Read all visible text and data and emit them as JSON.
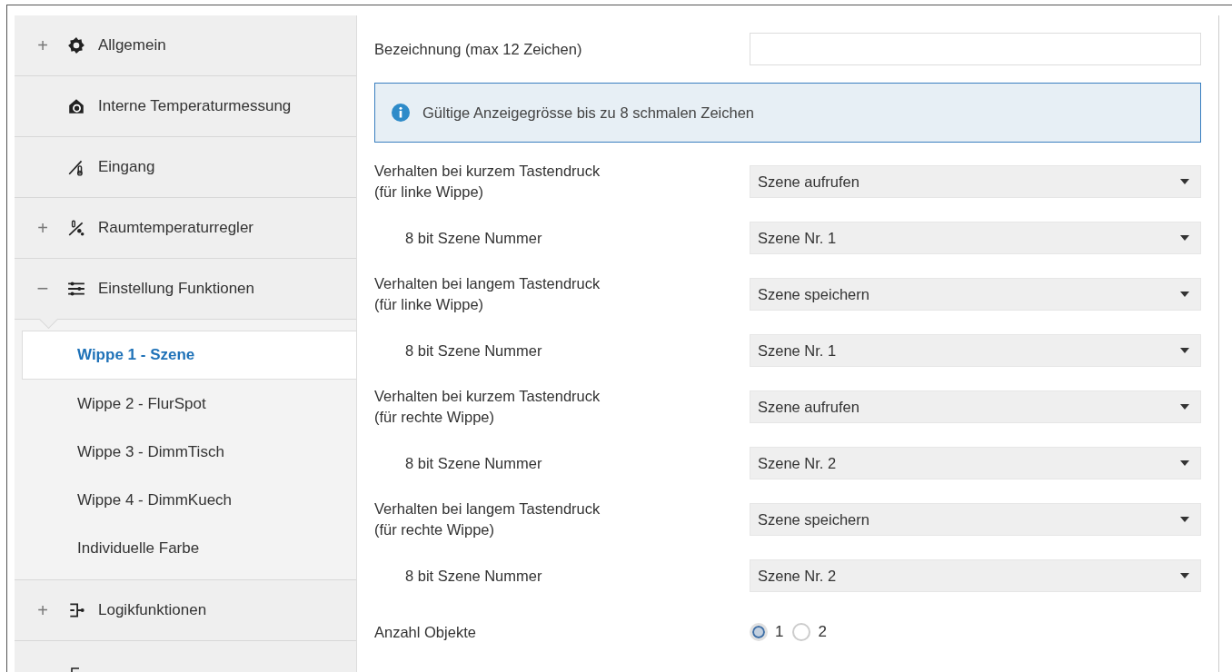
{
  "sidebar": {
    "items": [
      {
        "label": "Allgemein",
        "expander": "+"
      },
      {
        "label": "Interne Temperaturmessung"
      },
      {
        "label": "Eingang"
      },
      {
        "label": "Raumtemperaturregler",
        "expander": "+"
      },
      {
        "label": "Einstellung Funktionen",
        "expander": "−",
        "expanded": true,
        "children": [
          {
            "label": "Wippe 1 - Szene",
            "selected": true
          },
          {
            "label": "Wippe 2 - FlurSpot",
            "selected": false
          },
          {
            "label": "Wippe 3 - DimmTisch",
            "selected": false
          },
          {
            "label": "Wippe 4 - DimmKuech",
            "selected": false
          },
          {
            "label": "Individuelle Farbe",
            "selected": false
          }
        ]
      },
      {
        "label": "Logikfunktionen",
        "expander": "+"
      }
    ]
  },
  "form": {
    "name_field": {
      "label": "Bezeichnung (max 12 Zeichen)"
    },
    "info": "Gültige Anzeigegrösse bis zu 8 schmalen Zeichen",
    "params": [
      {
        "kind": "dropdown",
        "label": "Verhalten bei kurzem Tastendruck\n(für linke Wippe)",
        "indent": false,
        "value": "Szene aufrufen"
      },
      {
        "kind": "dropdown",
        "label": "8 bit Szene Nummer",
        "indent": true,
        "value": "Szene Nr. 1"
      },
      {
        "kind": "dropdown",
        "label": "Verhalten bei langem Tastendruck\n(für linke Wippe)",
        "indent": false,
        "value": "Szene speichern"
      },
      {
        "kind": "dropdown",
        "label": "8 bit Szene Nummer",
        "indent": true,
        "value": "Szene Nr. 1"
      },
      {
        "kind": "dropdown",
        "label": "Verhalten bei kurzem Tastendruck\n(für rechte Wippe)",
        "indent": false,
        "value": "Szene aufrufen"
      },
      {
        "kind": "dropdown",
        "label": "8 bit Szene Nummer",
        "indent": true,
        "value": "Szene Nr. 2"
      },
      {
        "kind": "dropdown",
        "label": "Verhalten bei langem Tastendruck\n(für rechte Wippe)",
        "indent": false,
        "value": "Szene speichern"
      },
      {
        "kind": "dropdown",
        "label": "8 bit Szene Nummer",
        "indent": true,
        "value": "Szene Nr. 2"
      },
      {
        "kind": "radio",
        "label": "Anzahl Objekte",
        "indent": false,
        "options": [
          {
            "label": "1",
            "selected": true
          },
          {
            "label": "2",
            "selected": false
          }
        ]
      }
    ]
  }
}
